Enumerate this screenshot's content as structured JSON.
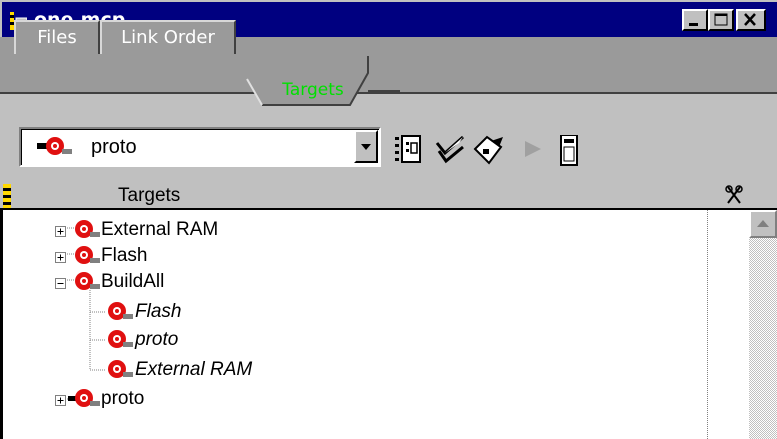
{
  "window": {
    "title": "one.mcp",
    "controls": [
      "minimize",
      "maximize",
      "close"
    ]
  },
  "tabs": [
    {
      "label": "Files",
      "active": false
    },
    {
      "label": "Link Order",
      "active": false
    },
    {
      "label": "Targets",
      "active": true
    }
  ],
  "toolbar": {
    "target_select": {
      "value": "proto",
      "icon": "target-icon"
    },
    "buttons": [
      {
        "name": "target-settings-icon"
      },
      {
        "name": "check-syntax-icon"
      },
      {
        "name": "make-icon"
      },
      {
        "name": "run-icon",
        "disabled": true
      },
      {
        "name": "project-inspector-icon"
      }
    ]
  },
  "list": {
    "header": "Targets",
    "items": [
      {
        "label": "External RAM",
        "level": 0,
        "expander": "+",
        "italic": false
      },
      {
        "label": "Flash",
        "level": 0,
        "expander": "+",
        "italic": false
      },
      {
        "label": "BuildAll",
        "level": 0,
        "expander": "-",
        "italic": false
      },
      {
        "label": "Flash",
        "level": 1,
        "expander": null,
        "italic": true
      },
      {
        "label": "proto",
        "level": 1,
        "expander": null,
        "italic": true
      },
      {
        "label": "External RAM",
        "level": 1,
        "expander": null,
        "italic": true
      },
      {
        "label": "proto",
        "level": 0,
        "expander": "+",
        "italic": false,
        "current": true
      }
    ]
  },
  "colors": {
    "titlebar": "#000080",
    "active_tab_text": "#00e000",
    "target_icon": "#e01010"
  }
}
